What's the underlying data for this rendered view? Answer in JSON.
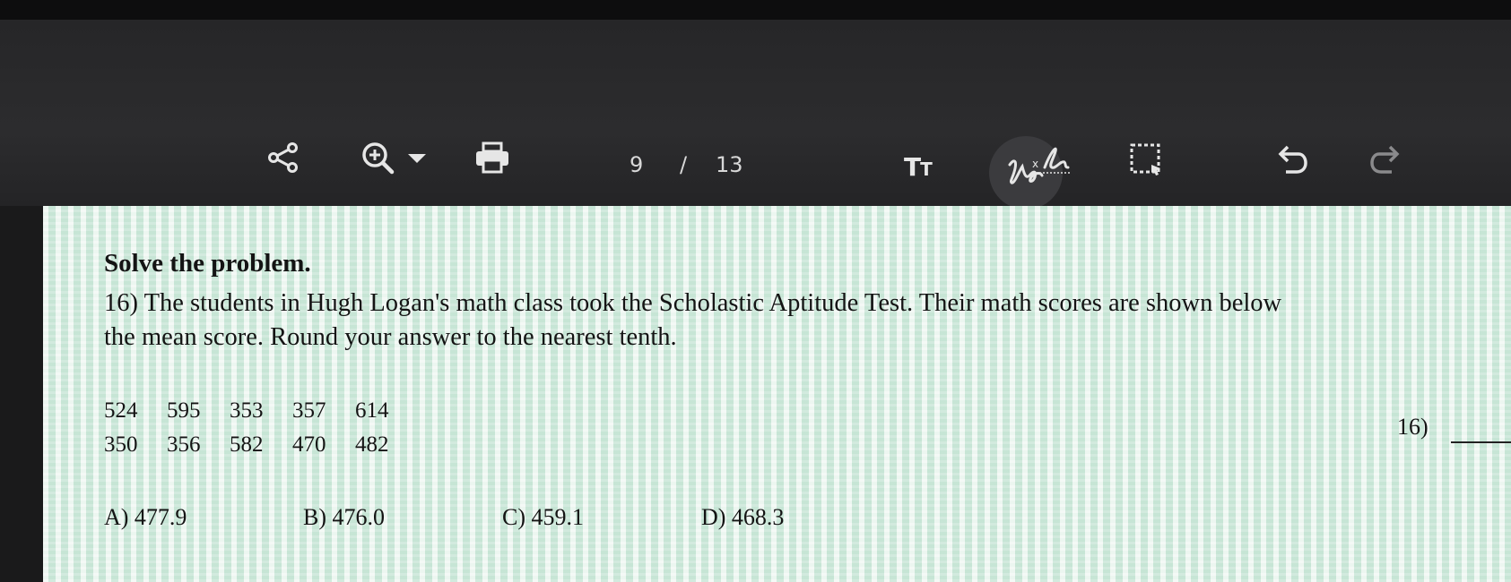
{
  "toolbar": {
    "page_current": "9",
    "page_separator": "/",
    "page_total": "13",
    "text_tool_label": "T",
    "text_tool_label_small": "T",
    "icons": [
      "share-icon",
      "zoom-in-icon",
      "dropdown-arrow-icon",
      "print-icon",
      "text-size-icon",
      "signature-icon",
      "fill-sign-icon",
      "selection-icon",
      "undo-icon",
      "redo-icon"
    ]
  },
  "document": {
    "heading": "Solve the problem.",
    "question_line1": "16) The students in Hugh Logan's math class took the Scholastic Aptitude Test. Their math scores are shown below",
    "question_line2": "the mean score. Round your answer to the nearest tenth.",
    "scores": [
      [
        "524",
        "595",
        "353",
        "357",
        "614"
      ],
      [
        "350",
        "356",
        "582",
        "470",
        "482"
      ]
    ],
    "answer_label": "16)",
    "choices": [
      "A) 477.9",
      "B) 476.0",
      "C) 459.1",
      "D) 468.3"
    ]
  },
  "colors": {
    "toolbar_bg": "#2a2a2c",
    "page_bg": "#dfeee6",
    "icon_color": "#e6e6e6"
  }
}
